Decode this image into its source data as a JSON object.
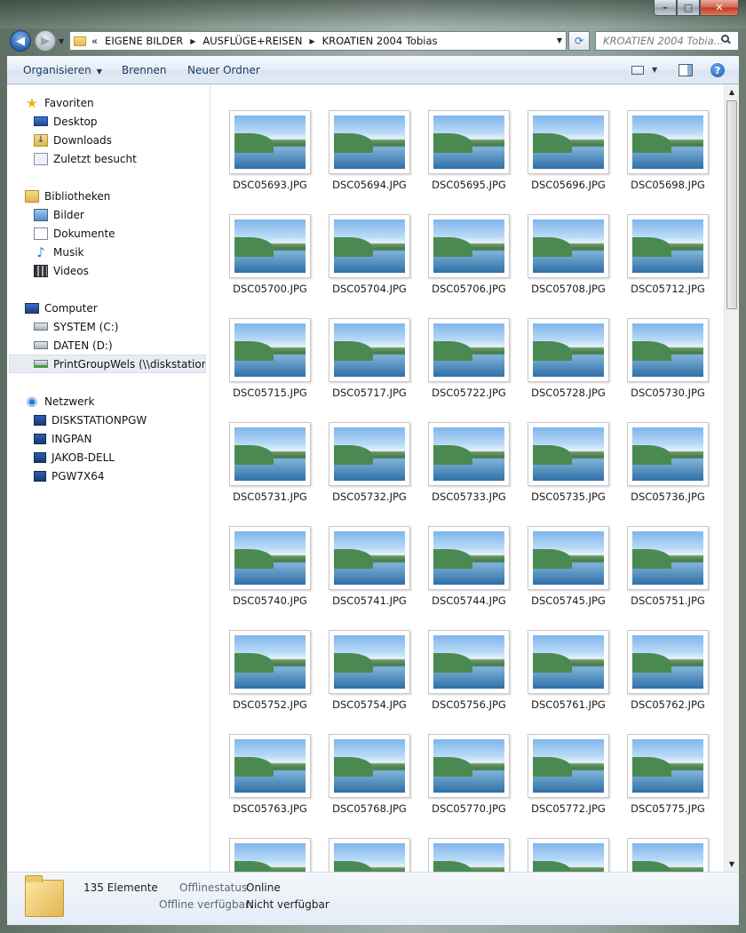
{
  "window": {
    "caption_buttons": {
      "minimize": "–",
      "maximize": "□",
      "close": "✕"
    }
  },
  "address": {
    "chevron": "«",
    "crumbs": [
      "EIGENE BILDER",
      "AUSFLÜGE+REISEN",
      "KROATIEN 2004 Tobias"
    ],
    "search_placeholder": "KROATIEN 2004 Tobia..."
  },
  "toolbar": {
    "organize": "Organisieren",
    "burn": "Brennen",
    "new_folder": "Neuer Ordner"
  },
  "nav": {
    "favorites_header": "Favoriten",
    "favorites": [
      "Desktop",
      "Downloads",
      "Zuletzt besucht"
    ],
    "libraries_header": "Bibliotheken",
    "libraries": [
      "Bilder",
      "Dokumente",
      "Musik",
      "Videos"
    ],
    "computer_header": "Computer",
    "drives": [
      "SYSTEM (C:)",
      "DATEN (D:)",
      "PrintGroupWels (\\\\diskstationpgw"
    ],
    "network_header": "Netzwerk",
    "network": [
      "DISKSTATIONPGW",
      "INGPAN",
      "JAKOB-DELL",
      "PGW7X64"
    ]
  },
  "files": [
    "DSC05693.JPG",
    "DSC05694.JPG",
    "DSC05695.JPG",
    "DSC05696.JPG",
    "DSC05698.JPG",
    "DSC05700.JPG",
    "DSC05704.JPG",
    "DSC05706.JPG",
    "DSC05708.JPG",
    "DSC05712.JPG",
    "DSC05715.JPG",
    "DSC05717.JPG",
    "DSC05722.JPG",
    "DSC05728.JPG",
    "DSC05730.JPG",
    "DSC05731.JPG",
    "DSC05732.JPG",
    "DSC05733.JPG",
    "DSC05735.JPG",
    "DSC05736.JPG",
    "DSC05740.JPG",
    "DSC05741.JPG",
    "DSC05744.JPG",
    "DSC05745.JPG",
    "DSC05751.JPG",
    "DSC05752.JPG",
    "DSC05754.JPG",
    "DSC05756.JPG",
    "DSC05761.JPG",
    "DSC05762.JPG",
    "DSC05763.JPG",
    "DSC05768.JPG",
    "DSC05770.JPG",
    "DSC05772.JPG",
    "DSC05775.JPG",
    "",
    "",
    "",
    "",
    ""
  ],
  "details": {
    "count": "135 Elemente",
    "offline_status_label": "Offlinestatus:",
    "offline_status_value": "Online",
    "offline_avail_label": "Offline verfügbar:",
    "offline_avail_value": "Nicht verfügbar"
  }
}
